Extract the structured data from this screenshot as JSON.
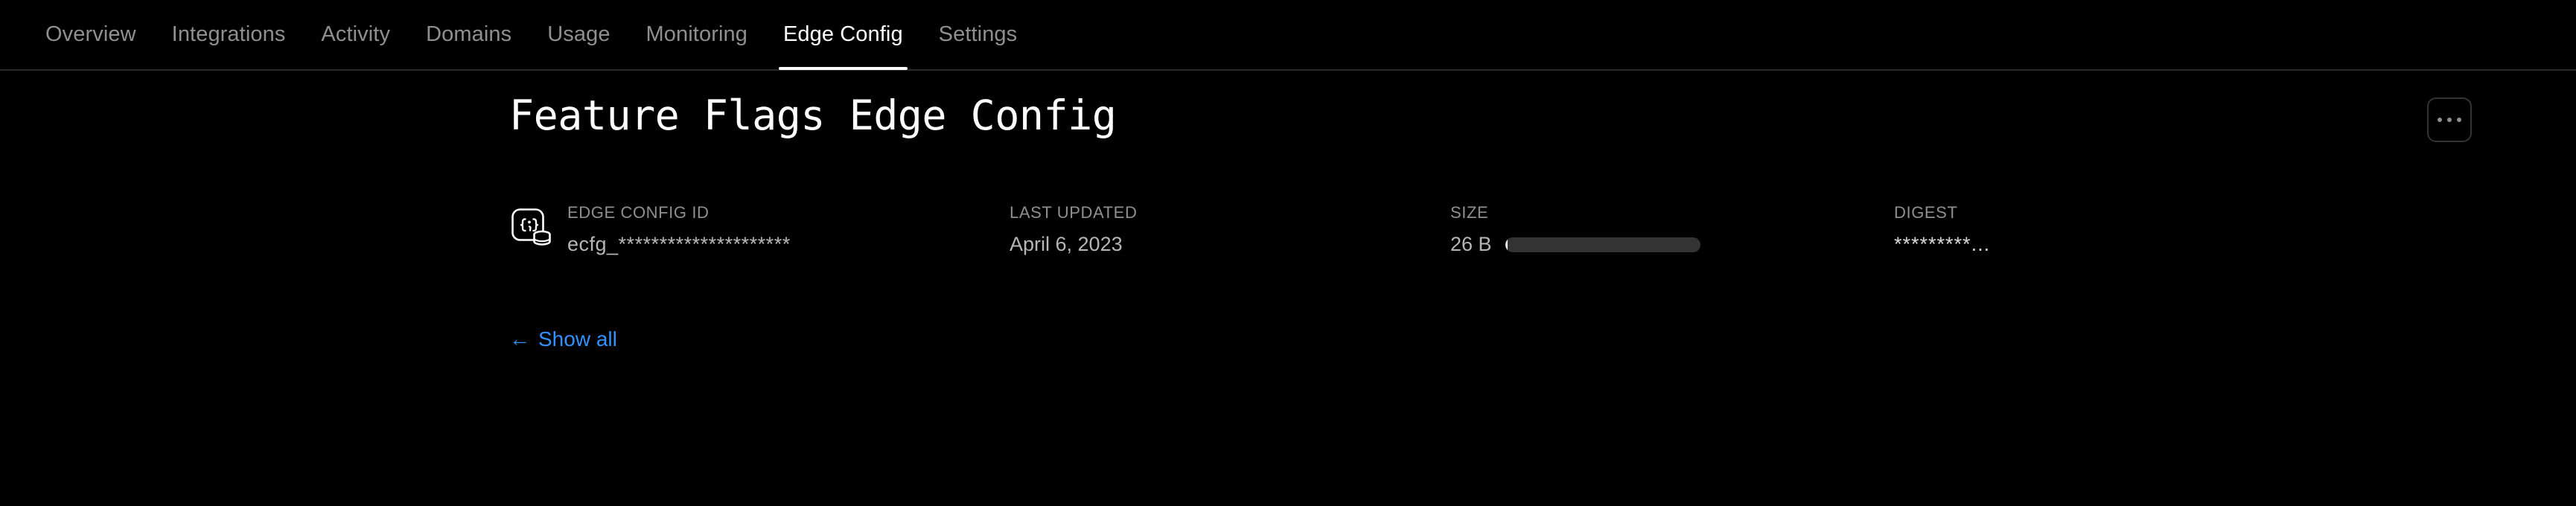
{
  "nav": {
    "tabs": [
      {
        "label": "Overview",
        "active": false
      },
      {
        "label": "Integrations",
        "active": false
      },
      {
        "label": "Activity",
        "active": false
      },
      {
        "label": "Domains",
        "active": false
      },
      {
        "label": "Usage",
        "active": false
      },
      {
        "label": "Monitoring",
        "active": false
      },
      {
        "label": "Edge Config",
        "active": true
      },
      {
        "label": "Settings",
        "active": false
      }
    ]
  },
  "header": {
    "title": "Feature Flags Edge Config",
    "menu_button_label": "..."
  },
  "meta": {
    "edge_config_id": {
      "label": "EDGE CONFIG ID",
      "value": "ecfg_*********************",
      "icon": "edge-config-icon"
    },
    "last_updated": {
      "label": "LAST UPDATED",
      "value": "April 6, 2023"
    },
    "size": {
      "label": "SIZE",
      "value": "26 B",
      "bar_percent": 1
    },
    "digest": {
      "label": "DIGEST",
      "value": "*********..."
    }
  },
  "footer": {
    "show_all_arrow": "←",
    "show_all_label": "Show all"
  },
  "colors": {
    "background": "#000000",
    "accent_blue": "#3291ff",
    "text_primary": "#ffffff",
    "text_muted": "#8f8f8f",
    "border": "#2a2a2a"
  }
}
